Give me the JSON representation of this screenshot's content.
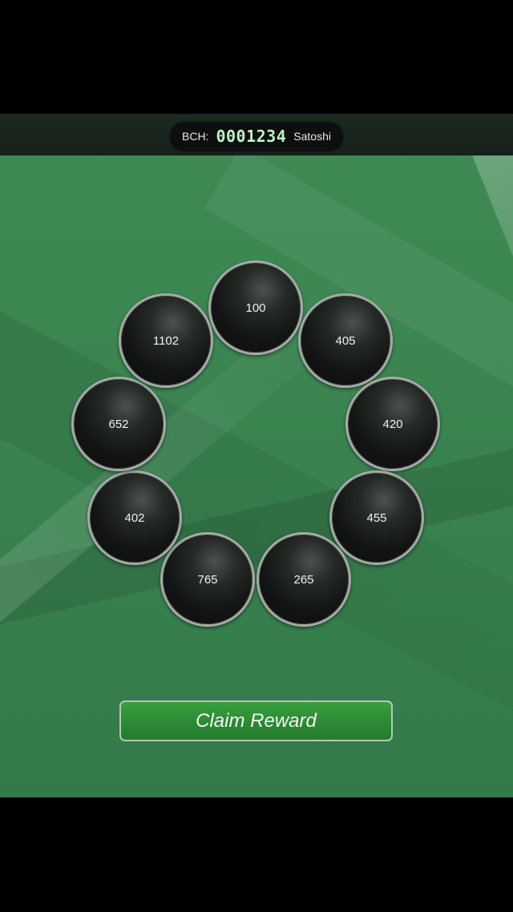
{
  "balance": {
    "label": "BCH:",
    "value": "0001234",
    "unit": "Satoshi"
  },
  "coins": [
    {
      "value": "100"
    },
    {
      "value": "405"
    },
    {
      "value": "420"
    },
    {
      "value": "455"
    },
    {
      "value": "265"
    },
    {
      "value": "765"
    },
    {
      "value": "402"
    },
    {
      "value": "652"
    },
    {
      "value": "1102"
    }
  ],
  "claim_button": {
    "label": "Claim Reward"
  },
  "colors": {
    "background": "#3a8350",
    "top_bar": "#15201a",
    "balance_value": "#bff2c4",
    "coin": "#121513",
    "coin_border": "#a6aaa7",
    "button": "#2c8c34"
  }
}
